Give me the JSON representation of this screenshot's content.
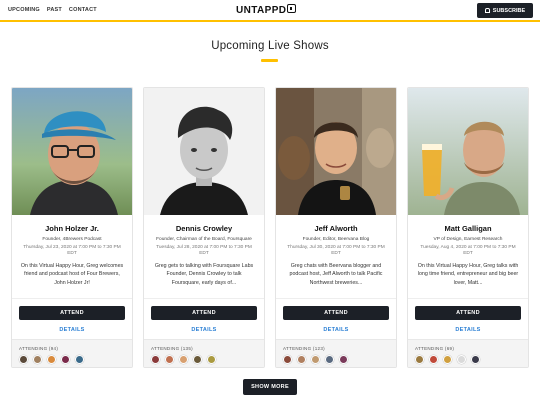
{
  "nav": {
    "items": [
      "UPCOMING",
      "PAST",
      "CONTACT"
    ]
  },
  "brand": {
    "logo_text": "UNTAPPD",
    "logo_icon": "untappd-mug-icon"
  },
  "header": {
    "subscribe_label": "SUBSCRIBE",
    "subscribe_icon": "bell-icon"
  },
  "page": {
    "title": "Upcoming Live Shows",
    "show_more_label": "SHOW MORE"
  },
  "colors": {
    "accent": "#ffc000",
    "dark": "#1c2027",
    "link": "#2a7fd4"
  },
  "cards": [
    {
      "name": "John Holzer Jr.",
      "role": "Founder, 4Brewers Podcast",
      "when": "Thursday, Jul 23, 2020 at 7:00 PM to 7:30 PM EDT",
      "description": "On this Virtual Happy Hour, Greg welcomes friend and podcast host of Four Brewers, John Holzer Jr!",
      "attend_label": "ATTEND",
      "details_label": "DETAILS",
      "attending_label": "ATTENDING (94)",
      "avatar_colors": [
        "#5b4a3a",
        "#a08060",
        "#d98a3c",
        "#7a2a4a",
        "#3a6a8a"
      ]
    },
    {
      "name": "Dennis Crowley",
      "role": "Founder, Chairman of the Board, Foursquare",
      "when": "Tuesday, Jul 28, 2020 at 7:00 PM to 7:30 PM EDT",
      "description": "Greg gets to talking with Foursquare Labs Founder, Dennis Crowley to talk Foursquare, early days of...",
      "attend_label": "ATTEND",
      "details_label": "DETAILS",
      "attending_label": "ATTENDING (135)",
      "avatar_colors": [
        "#8a3a3a",
        "#c07050",
        "#d8a070",
        "#6a5a3a",
        "#aa9a40"
      ]
    },
    {
      "name": "Jeff Alworth",
      "role": "Founder, Editor, Beervana Blog",
      "when": "Thursday, Jul 30, 2020 at 7:00 PM to 7:30 PM EDT",
      "description": "Greg chats with Beervana blogger and podcast host, Jeff Alworth to talk Pacific Northwest breweries...",
      "attend_label": "ATTEND",
      "details_label": "DETAILS",
      "attending_label": "ATTENDING (123)",
      "avatar_colors": [
        "#8a4a3a",
        "#b08060",
        "#c09a70",
        "#5a6a80",
        "#7a3a5a"
      ]
    },
    {
      "name": "Matt Galligan",
      "role": "VP of Design, Earnest Research",
      "when": "Tuesday, Aug 4, 2020 at 7:00 PM to 7:30 PM EDT",
      "description": "On this Virtual Happy Hour, Greg talks with long time friend, entrepreneur and big beer lover, Matt...",
      "attend_label": "ATTEND",
      "details_label": "DETAILS",
      "attending_label": "ATTENDING (69)",
      "avatar_colors": [
        "#9a7a40",
        "#c04a3a",
        "#d0a040",
        "#dadada",
        "#3a3a4a"
      ]
    }
  ]
}
